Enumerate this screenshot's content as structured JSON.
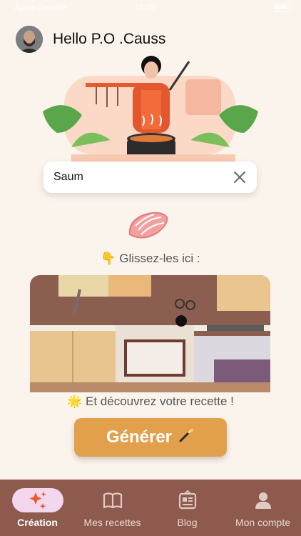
{
  "statusbar": {
    "carrier": "Apple Service",
    "time": "10:05"
  },
  "header": {
    "greeting": "Hello P.O .Causs"
  },
  "search": {
    "value": "Saum",
    "placeholder": ""
  },
  "dropzone": {
    "label": "👇 Glissez-les ici :"
  },
  "discover": {
    "label": "🌟 Et découvrez votre recette !"
  },
  "generate": {
    "label": "Générer",
    "icon": "magic-wand-icon"
  },
  "tabs": [
    {
      "label": "Création",
      "icon": "sparkles-icon",
      "active": true
    },
    {
      "label": "Mes recettes",
      "icon": "open-book-icon",
      "active": false
    },
    {
      "label": "Blog",
      "icon": "newspaper-icon",
      "active": false
    },
    {
      "label": "Mon compte",
      "icon": "user-icon",
      "active": false
    }
  ],
  "colors": {
    "background": "#fbf4ec",
    "tabbar": "#8e5a4e",
    "accent": "#e2a04c",
    "active_tab": "#f2d7ee"
  }
}
